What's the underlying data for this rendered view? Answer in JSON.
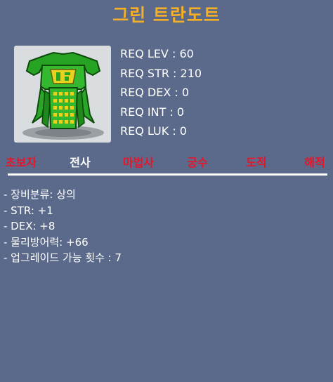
{
  "item": {
    "name": "그린 트란도트",
    "image_icon": "green-armor-icon"
  },
  "requirements": [
    {
      "label": "REQ LEV",
      "value": "60",
      "text": "REQ LEV : 60"
    },
    {
      "label": "REQ STR",
      "value": "210",
      "text": "REQ STR : 210"
    },
    {
      "label": "REQ DEX",
      "value": "0",
      "text": "REQ DEX : 0"
    },
    {
      "label": "REQ INT",
      "value": "0",
      "text": "REQ INT : 0"
    },
    {
      "label": "REQ LUK",
      "value": "0",
      "text": "REQ LUK : 0"
    }
  ],
  "jobs": [
    {
      "name": "초보자",
      "allowed": false
    },
    {
      "name": "전사",
      "allowed": true
    },
    {
      "name": "마법사",
      "allowed": false
    },
    {
      "name": "궁수",
      "allowed": false
    },
    {
      "name": "도적",
      "allowed": false
    },
    {
      "name": "해적",
      "allowed": false
    }
  ],
  "stats": [
    "- 장비분류: 상의",
    "- STR: +1",
    "- DEX: +8",
    "- 물리방어력: +66",
    "- 업그레이드 가능 횟수 : 7"
  ],
  "colors": {
    "background": "#5b6a8b",
    "title": "#f5b027",
    "job_allowed": "#ffffff",
    "job_disallowed": "#e8142a",
    "text": "#ffffff"
  }
}
